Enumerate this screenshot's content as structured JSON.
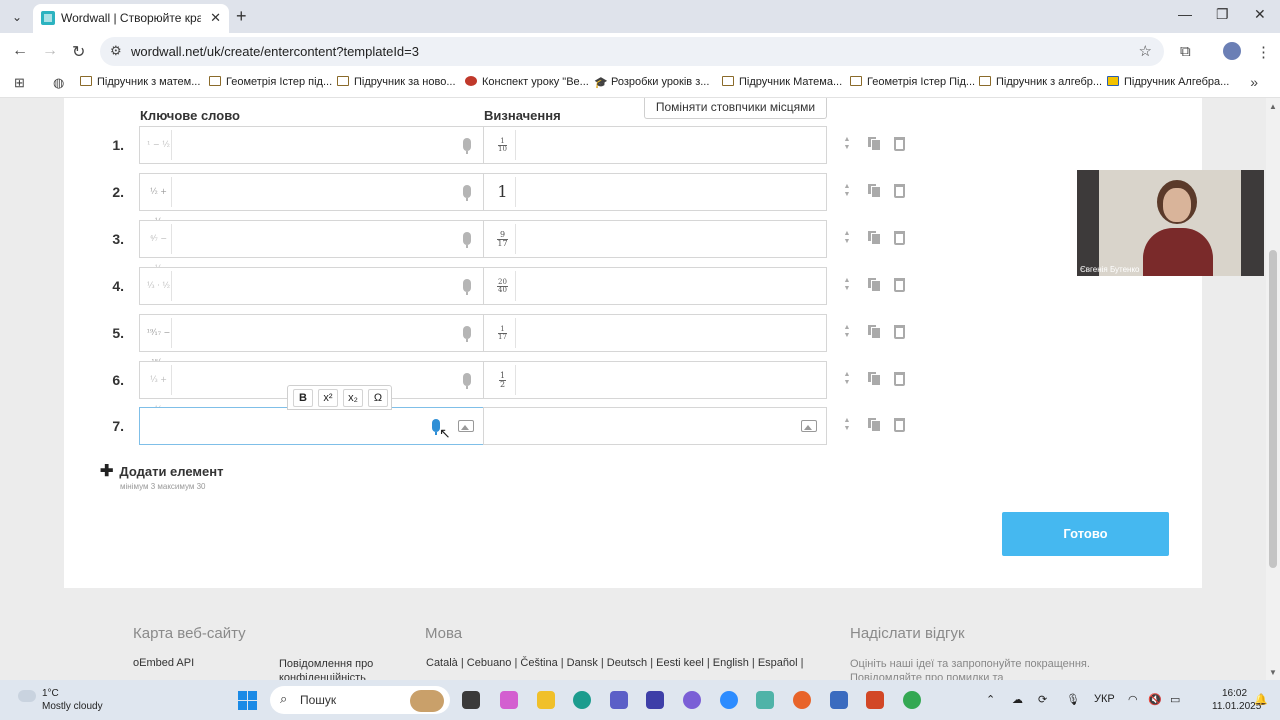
{
  "browser": {
    "tab_title": "Wordwall | Створюйте кращі у",
    "tab_close": "✕",
    "new_tab": "+",
    "url": "wordwall.net/uk/create/entercontent?templateId=3",
    "bookmarks": [
      "Підручник з матем...",
      "Геометрія Істер під...",
      "Підручник за ново...",
      "Конспект уроку \"Ве...",
      "Розробки уроків з...",
      "Підручник Матема...",
      "Геометрія Істер Під...",
      "Підручник з алгебр...",
      "Підручник Алгебра..."
    ]
  },
  "editor": {
    "col_keyword": "Ключове слово",
    "col_definition": "Визначення",
    "swap_button": "Поміняти стовпчики місцями",
    "rows": [
      {
        "num": "1.",
        "key": "¹ − ½",
        "def_n": "1",
        "def_d": "10"
      },
      {
        "num": "2.",
        "key": "½ + ½",
        "def_whole": "1"
      },
      {
        "num": "3.",
        "key": "⁴⁄₇ − ⅛",
        "def_n": "9",
        "def_d": "17"
      },
      {
        "num": "4.",
        "key": "⅓ · ½",
        "def_n": "20",
        "def_d": "40"
      },
      {
        "num": "5.",
        "key": "¹⁹⁄₁₇ − ¹⁸⁄₁₇",
        "def_n": "1",
        "def_d": "17"
      },
      {
        "num": "6.",
        "key": "⅓ + ⅙",
        "def_n": "1",
        "def_d": "2"
      },
      {
        "num": "7."
      }
    ],
    "format_toolbar": {
      "bold": "B",
      "superscript": "x²",
      "subscript": "x₂",
      "special_chars": "Ω"
    },
    "add_item": "Додати елемент",
    "limits": "мінімум 3   максимум 30",
    "done_button": "Готово"
  },
  "footer": {
    "sitemap_heading": "Карта веб-сайту",
    "language_heading": "Мова",
    "feedback_heading": "Надіслати відгук",
    "link_oembed": "oEmbed API",
    "link_privacy": "Повідомлення про конфіденційність",
    "languages": "Català  |  Cebuano  |  Čeština  |  Dansk  |  Deutsch  |  Eesti keel  |  English  |  Español  |",
    "feedback_text": "Оцініть наші ідеї та запропонуйте покращення. Повідомляйте про помилки та"
  },
  "webcam": {
    "name": "Євгенія Бутенко"
  },
  "taskbar": {
    "temperature": "1°C",
    "weather": "Mostly cloudy",
    "search_label": "Пошук",
    "language": "УКР",
    "time": "16:02",
    "date": "11.01.2025"
  },
  "colors": {
    "accent": "#45b8f0",
    "mic_active": "#2f8fd6"
  }
}
